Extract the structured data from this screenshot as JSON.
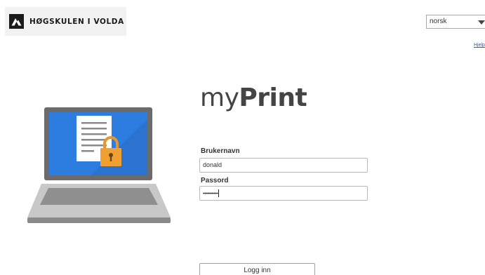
{
  "header": {
    "logo_text": "HØGSKULEN I VOLDA",
    "language": {
      "selected": "norsk"
    },
    "help_link": "Hjelp"
  },
  "main": {
    "title_light": "my",
    "title_bold": "Print",
    "username": {
      "label": "Brukernavn",
      "value": "donald"
    },
    "password": {
      "label": "Passord",
      "masked_value": "•••••••••••"
    },
    "login_button": "Logg inn"
  },
  "colors": {
    "screen_blue": "#2d7de0",
    "laptop_gray": "#6b6b6b",
    "lock_orange": "#f0a030"
  }
}
